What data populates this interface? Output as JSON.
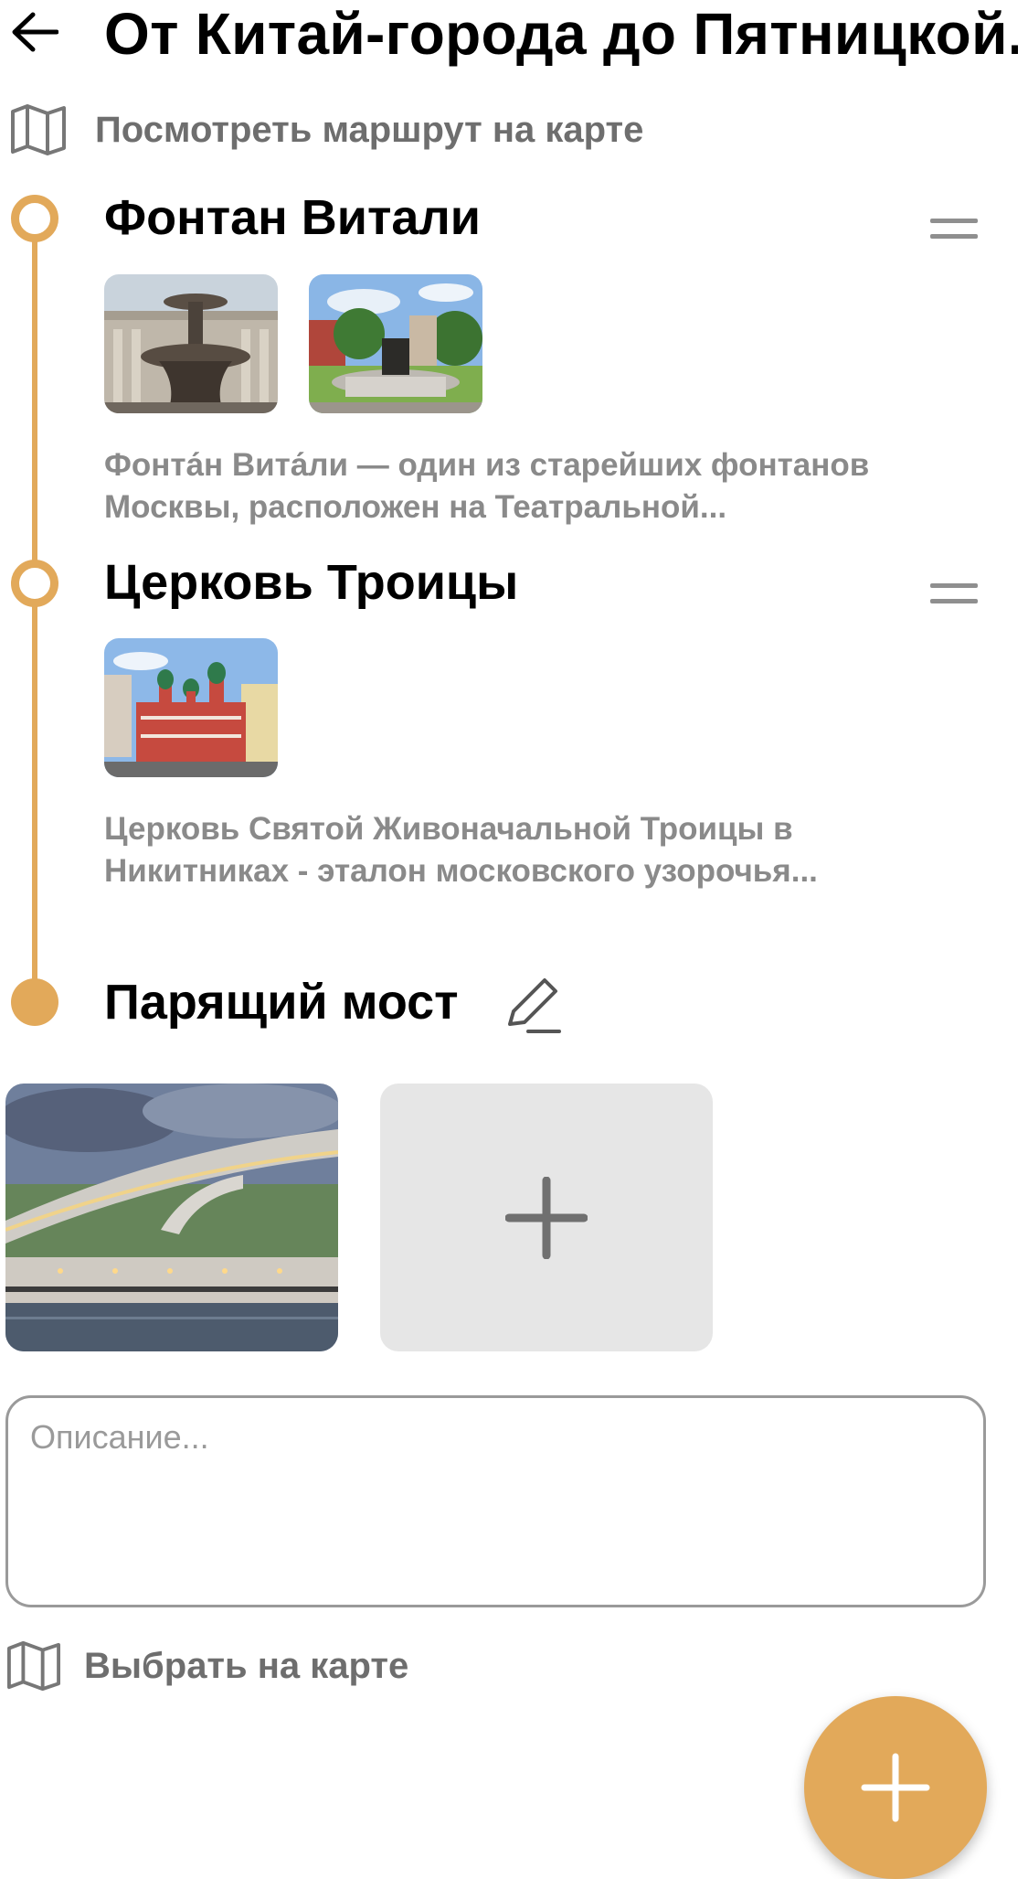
{
  "header": {
    "title": "От Китай-города до Пятницкой...",
    "back_icon": "arrow-left-icon"
  },
  "route_map_link": {
    "label": "Посмотреть маршрут на карте",
    "icon": "map-icon"
  },
  "accent_color": "#e2a95a",
  "stops": [
    {
      "title": "Фонтан Витали",
      "photos": [
        "fountain-photo-1",
        "fountain-photo-2"
      ],
      "description_line1": "Фонта́н Вита́ли — один из старейших фонтанов",
      "description_line2": "Москвы,  расположен на Театральной..."
    },
    {
      "title": "Церковь Троицы",
      "photos": [
        "church-photo"
      ],
      "description_line1": "Церковь Святой Живоначальной Троицы в",
      "description_line2": "Никитниках - эталон московского узорочья..."
    }
  ],
  "editing_stop": {
    "title": "Парящий мост",
    "description_placeholder": "Описание...",
    "description_value": "",
    "choose_on_map_label": "Выбрать на карте"
  }
}
